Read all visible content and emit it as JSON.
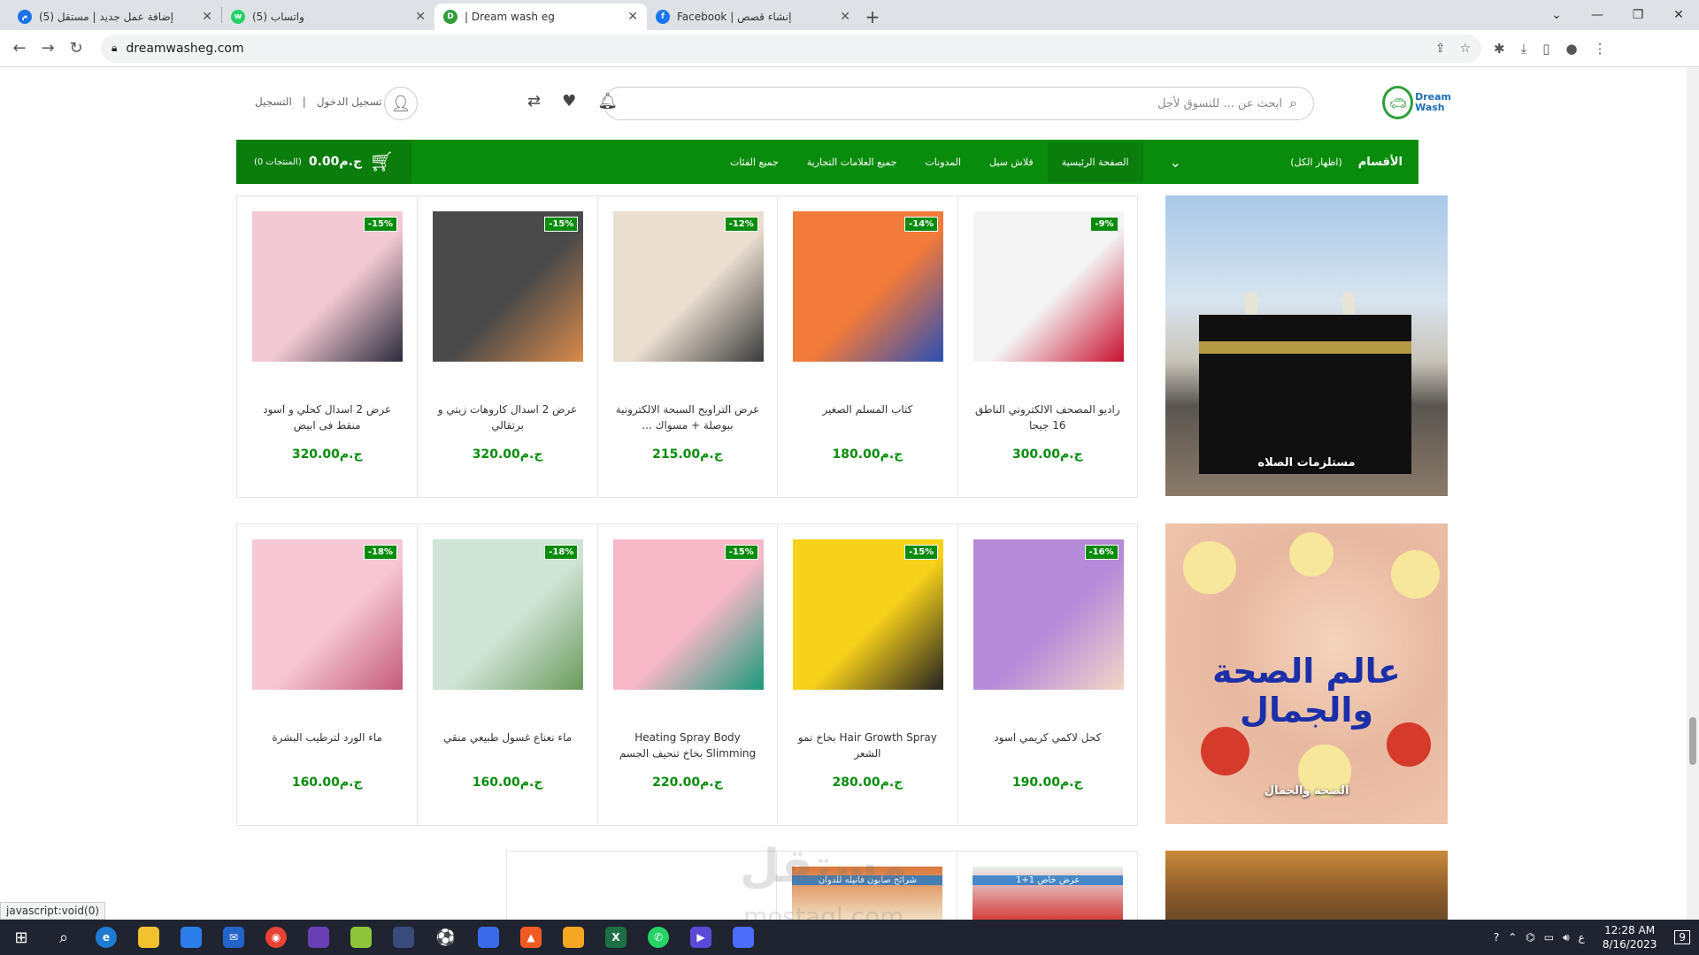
{
  "browser": {
    "tabs": [
      {
        "title": "(5) إضافة عمل جديد | مستقل",
        "color": "#1a73e8",
        "letter": "م"
      },
      {
        "title": "(5) واتساب",
        "color": "#25d366",
        "letter": "w"
      },
      {
        "title": "| Dream wash eg",
        "color": "#2e9d3a",
        "letter": "D",
        "active": true
      },
      {
        "title": "Facebook | إنشاء قصص",
        "color": "#1877f2",
        "letter": "f"
      }
    ],
    "url": "dreamwasheg.com",
    "status": "javascript:void(0)"
  },
  "header": {
    "logo_line1": "Dream",
    "logo_line2": "Wash",
    "search_placeholder": "ابحث عن ... للتسوق لأجل",
    "login": "تسجيل الدخول",
    "register": "التسجيل",
    "separator": "|"
  },
  "nav": {
    "categories_title": "الأقسام",
    "categories_all": "(اظهار الكل)",
    "links": [
      "الصفحة الرئيسية",
      "فلاش سيل",
      "المدونات",
      "جميع العلامات التجارية",
      "جميع الفئات"
    ],
    "cart_total": "ج.م0.00",
    "cart_count": "(0 المنتجات)"
  },
  "banners": {
    "prayer": "مستلزمات الصلاه",
    "health": "الصحة والجمال",
    "health_headline": "عالم الصحة والجمال"
  },
  "rows": [
    [
      {
        "name": "راديو المصحف الالكتروني الناطق 16 جيجا",
        "price": "ج.م300.00",
        "discount": "-9%",
        "colors": [
          "#f4f4f4",
          "#c8102e"
        ]
      },
      {
        "name": "كتاب المسلم الصغير",
        "price": "ج.م180.00",
        "discount": "-14%",
        "colors": [
          "#f27a3a",
          "#2a4fb5"
        ]
      },
      {
        "name": "عرض التراويح السبحة الالكترونية ببوصلة + مسواك ...",
        "price": "ج.م215.00",
        "discount": "-12%",
        "colors": [
          "#e9ded0",
          "#3a3a3a"
        ]
      },
      {
        "name": "عرض 2 اسدال كاروهات زيتي و برتقالي",
        "price": "ج.م320.00",
        "discount": "-15%",
        "colors": [
          "#4a4a4a",
          "#d98b4a"
        ]
      },
      {
        "name": "عرض 2 اسدال كحلي و اسود منقط فى ابيض",
        "price": "ج.م320.00",
        "discount": "-15%",
        "colors": [
          "#f3c9d3",
          "#2a2a3a"
        ]
      }
    ],
    [
      {
        "name": "كحل لاكمي كريمي اسود",
        "price": "ج.م190.00",
        "discount": "-16%",
        "colors": [
          "#b58ad8",
          "#f2d6c8"
        ]
      },
      {
        "name": "Hair Growth Spray بخاخ نمو الشعر",
        "price": "ج.م280.00",
        "discount": "-15%",
        "colors": [
          "#f7d21a",
          "#222222"
        ]
      },
      {
        "name": "Heating Spray Body Slimming بخاخ تنحيف الجسم",
        "price": "ج.م220.00",
        "discount": "-15%",
        "colors": [
          "#f7b8c8",
          "#1a9a7a"
        ]
      },
      {
        "name": "ماء نعناع غسول طبيعي منقي",
        "price": "ج.م160.00",
        "discount": "-18%",
        "colors": [
          "#cfe3d6",
          "#6a9a5a"
        ]
      },
      {
        "name": "ماء الورد لترطيب البشرة",
        "price": "ج.م160.00",
        "discount": "-18%",
        "colors": [
          "#f6c8d6",
          "#c45a7a"
        ]
      }
    ]
  ],
  "row3": [
    {
      "title": "عرض خاص 1+1",
      "colors": [
        "#e8f0ee",
        "#d43a3a"
      ]
    },
    {
      "title": "شرائح صابون فانيله للدوان",
      "colors": [
        "#d9773a",
        "#f2e2c8"
      ]
    }
  ],
  "watermark": {
    "line1": "مستقل",
    "line2": "mostaql.com"
  },
  "taskbar": {
    "time": "12:28 AM",
    "date": "8/16/2023",
    "lang": "ع",
    "notifications": "9"
  }
}
